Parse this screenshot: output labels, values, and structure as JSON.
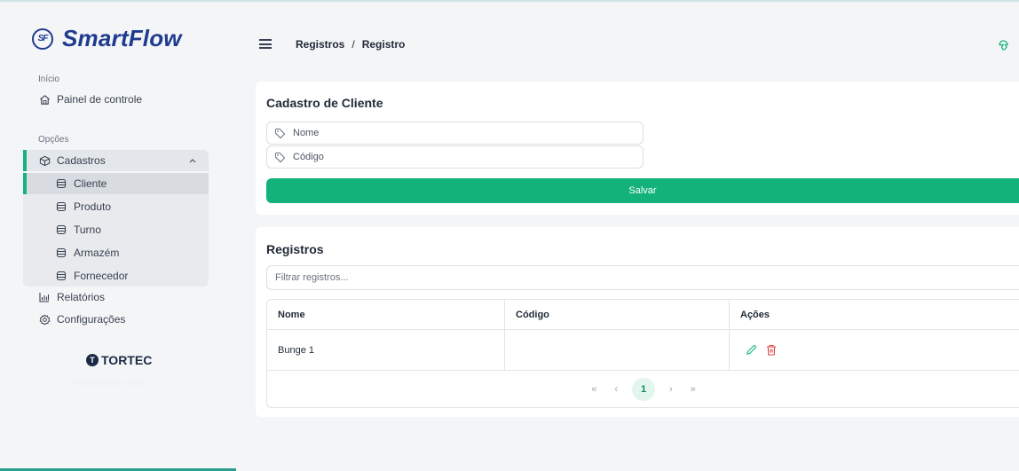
{
  "brand": {
    "mark": "SF",
    "name": "SmartFlow"
  },
  "sidebar": {
    "section_inicio": "Início",
    "painel": "Painel de controle",
    "section_opcoes": "Opções",
    "cadastros": "Cadastros",
    "sub_items": [
      "Cliente",
      "Produto",
      "Turno",
      "Armazém",
      "Fornecedor"
    ],
    "relatorios": "Relatórios",
    "configuracoes": "Configurações",
    "company": "TORTEC",
    "company_caption": "Powered by Tortec"
  },
  "header": {
    "crumb1": "Registros",
    "separator": "/",
    "crumb2": "Registro"
  },
  "form": {
    "title": "Cadastro de Cliente",
    "nome_placeholder": "Nome",
    "codigo_placeholder": "Código",
    "save_label": "Salvar"
  },
  "records": {
    "title": "Registros",
    "filter_placeholder": "Filtrar registros...",
    "columns": [
      "Nome",
      "Código",
      "Ações"
    ],
    "rows": [
      {
        "nome": "Bunge 1",
        "codigo": ""
      }
    ]
  },
  "pagination": {
    "first": "«",
    "prev": "‹",
    "current": "1",
    "next": "›",
    "last": "»"
  },
  "colors": {
    "accent": "#13b27b",
    "brand": "#1f3b8f",
    "danger": "#e04848"
  }
}
